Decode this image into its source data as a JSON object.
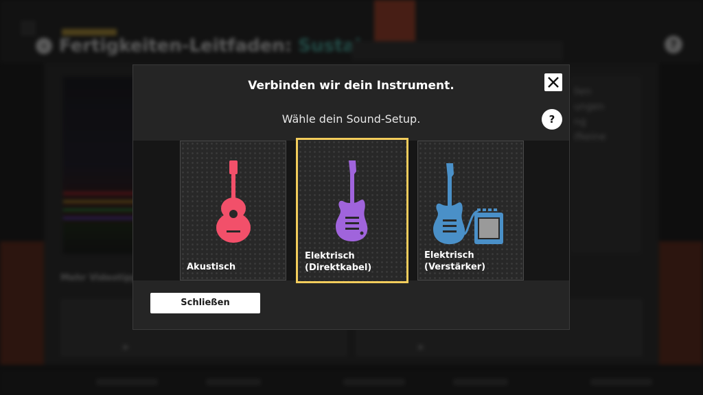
{
  "background": {
    "title_prefix": "Fertigkeiten-Leitfaden:",
    "title_accent": "Sustains",
    "back_icon": "chevron-left-icon",
    "help_icon": "question-icon",
    "section_label": "Mehr Videotipps"
  },
  "modal": {
    "heading": "Verbinden wir dein Instrument.",
    "subheading": "Wähle dein Sound-Setup.",
    "close_icon": "close-icon",
    "help_label": "?",
    "options": [
      {
        "label": "Akustisch",
        "icon": "acoustic-guitar-icon",
        "color": "#f2506a",
        "selected": false
      },
      {
        "label": "Elektrisch\n(Direktkabel)",
        "icon": "electric-guitar-icon",
        "color": "#a064dc",
        "selected": true
      },
      {
        "label": "Elektrisch\n(Verstärker)",
        "icon": "electric-guitar-amp-icon",
        "color": "#4a90c8",
        "selected": false
      }
    ],
    "close_button_label": "Schließen"
  },
  "colors": {
    "selection_border": "#f3cd5c",
    "accent_teal": "#4fc0b3"
  }
}
